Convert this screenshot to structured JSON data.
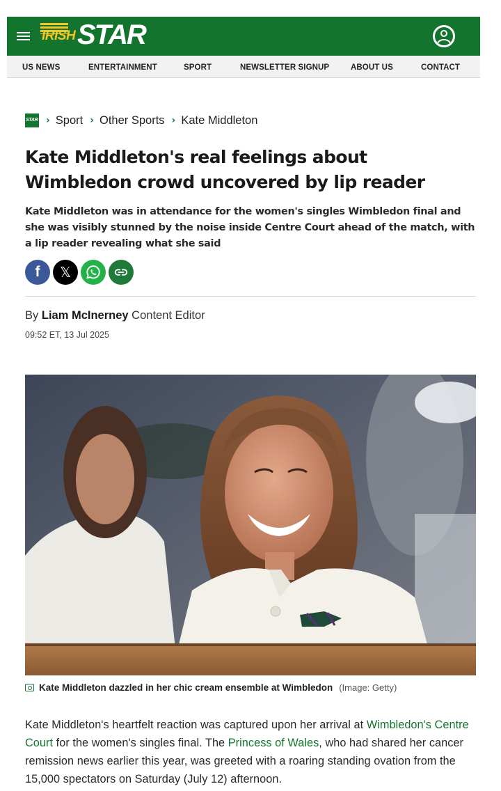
{
  "brand": {
    "logo_irish": "IRISH",
    "logo_star": "STAR",
    "mini_logo": "STAR",
    "primary_color": "#13742e",
    "accent_color": "#f5c526"
  },
  "header": {
    "menu_icon": "hamburger-menu-icon",
    "account_icon": "user-account-icon"
  },
  "nav": {
    "items": [
      "US NEWS",
      "ENTERTAINMENT",
      "SPORT",
      "NEWSLETTER SIGNUP",
      "ABOUT US",
      "CONTACT"
    ]
  },
  "breadcrumb": {
    "items": [
      "Sport",
      "Other Sports",
      "Kate Middleton"
    ],
    "separator": ">"
  },
  "article": {
    "headline": "Kate Middleton's real feelings about Wimbledon crowd uncovered by lip reader",
    "standfirst": "Kate Middleton was in attendance for the women's singles Wimbledon final and she was visibly stunned by the noise inside Centre Court ahead of the match, with a lip reader revealing what she said",
    "share": {
      "facebook_icon": "facebook-icon",
      "x_icon": "x-twitter-icon",
      "whatsapp_icon": "whatsapp-icon",
      "link_icon": "copy-link-icon"
    },
    "byline_prefix": "By",
    "author": "Liam McInerney",
    "author_role": "Content Editor",
    "timestamp": "09:52 ET, 13 Jul 2025",
    "image_caption": "Kate Middleton dazzled in her chic cream ensemble at Wimbledon",
    "image_credit": "(Image: Getty)",
    "body": {
      "p1_part1": "Kate Middleton's heartfelt reaction was captured upon her arrival at ",
      "p1_link1": "Wimbledon's Centre Court",
      "p1_part2": " for the women's singles final. The ",
      "p1_link2": "Princess of Wales",
      "p1_part3": ", who had shared her cancer remission news earlier this year, was greeted with a roaring standing ovation from the 15,000 spectators on Saturday (July 12) afternoon."
    }
  }
}
